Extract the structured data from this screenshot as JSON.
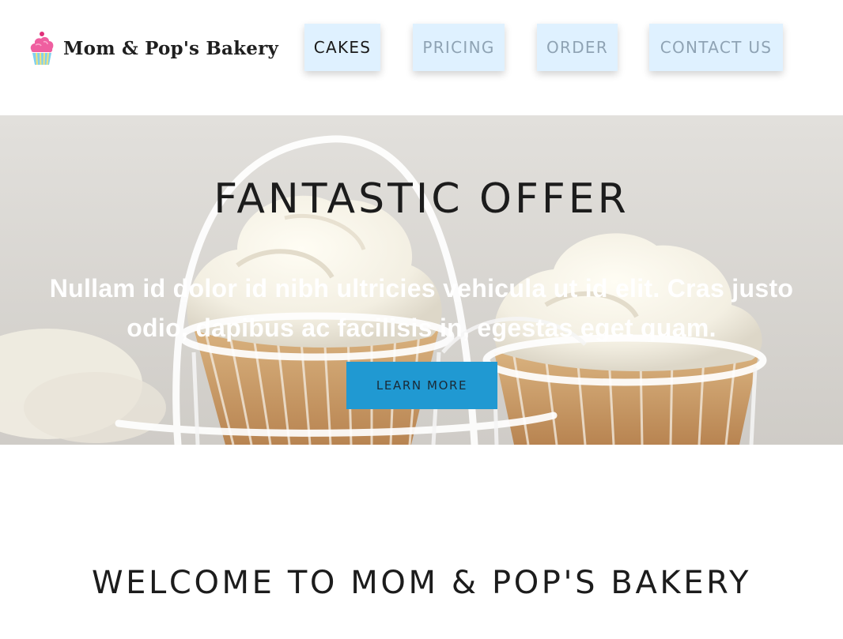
{
  "brand": {
    "name": "Mom & Pop's Bakery",
    "logo_icon": "cupcake-icon"
  },
  "nav": {
    "items": [
      {
        "label": "CAKES",
        "active": true
      },
      {
        "label": "PRICING",
        "active": false
      },
      {
        "label": "ORDER",
        "active": false
      },
      {
        "label": "CONTACT US",
        "active": false
      }
    ]
  },
  "hero": {
    "title": "FANTASTIC OFFER",
    "text": "Nullam id dolor id nibh ultricies vehicula ut id elit. Cras justo odio, dapibus ac facilisis in, egestas eget quam.",
    "button_label": "LEARN MORE",
    "image": "cupcakes-photo"
  },
  "welcome": {
    "heading": "WELCOME TO MOM & POP'S BAKERY"
  },
  "colors": {
    "nav_bg": "#dff1ff",
    "nav_inactive_text": "#8fa3b4",
    "button_bg": "#2099d2",
    "hero_text": "#ffffff"
  }
}
